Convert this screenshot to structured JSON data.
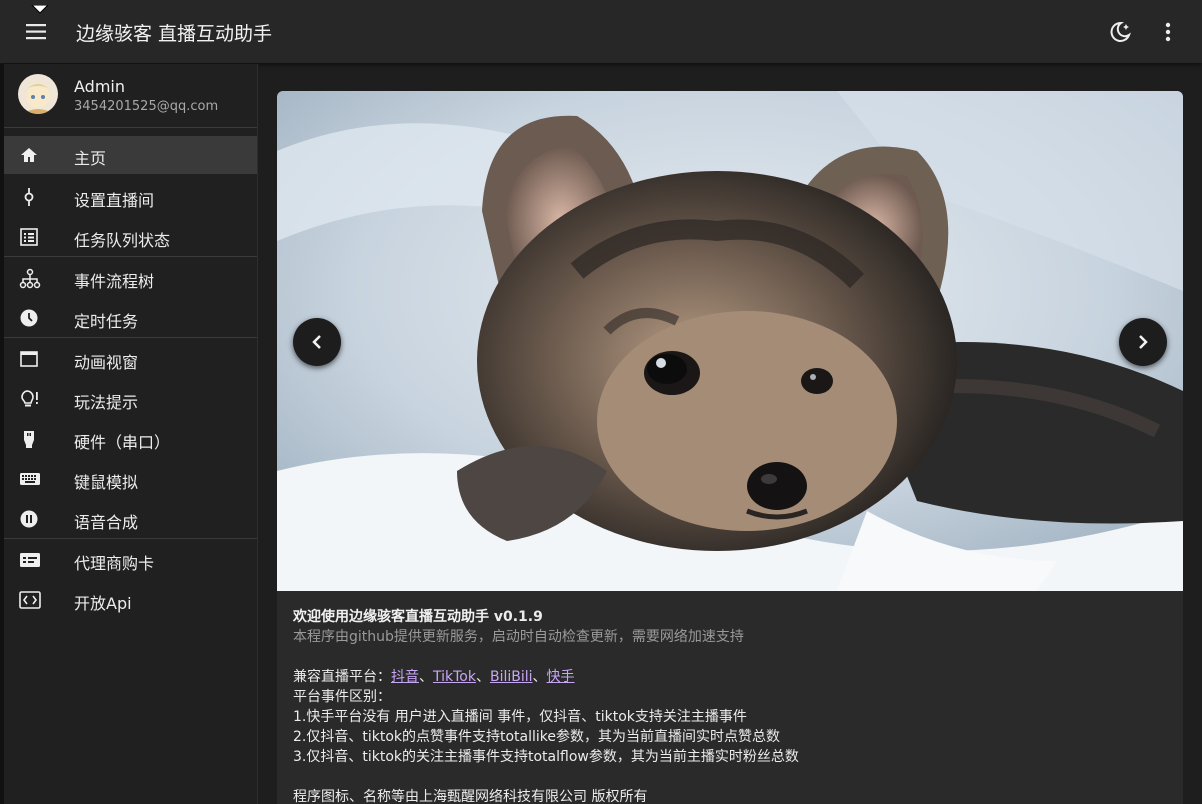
{
  "header": {
    "title": "边缘骇客 直播互动助手",
    "menu_icon": "hamburger-menu-icon",
    "theme_icon": "dark-mode-icon",
    "more_icon": "more-vertical-icon"
  },
  "user": {
    "name": "Admin",
    "email": "3454201525@qq.com"
  },
  "sidebar": {
    "items": [
      {
        "label": "主页",
        "icon": "home-icon",
        "active": true
      },
      {
        "label": "设置直播间",
        "icon": "live-connect-icon"
      },
      {
        "label": "任务队列状态",
        "icon": "list-icon"
      },
      {
        "label": "事件流程树",
        "icon": "tree-icon"
      },
      {
        "label": "定时任务",
        "icon": "clock-icon"
      },
      {
        "label": "动画视窗",
        "icon": "window-icon"
      },
      {
        "label": "玩法提示",
        "icon": "lightbulb-icon"
      },
      {
        "label": "硬件（串口）",
        "icon": "usb-icon"
      },
      {
        "label": "键鼠模拟",
        "icon": "keyboard-icon"
      },
      {
        "label": "语音合成",
        "icon": "voice-icon"
      },
      {
        "label": "代理商购卡",
        "icon": "card-icon"
      },
      {
        "label": "开放Api",
        "icon": "api-icon"
      }
    ]
  },
  "carousel": {
    "prev_icon": "chevron-left-icon",
    "next_icon": "chevron-right-icon",
    "image": "yorkshire-puppy-photo"
  },
  "content": {
    "welcome_text": "欢迎使用边缘骇客直播互动助手 ",
    "version": "v0.1.9",
    "update_note": "本程序由github提供更新服务，启动时自动检查更新，需要网络加速支持",
    "platforms_label": "兼容直播平台：",
    "platforms": [
      "抖音",
      "TikTok",
      "BiliBili",
      "快手"
    ],
    "separator": "、",
    "events_title": "平台事件区别：",
    "events": [
      "1.快手平台没有 用户进入直播间 事件，仅抖音、tiktok支持关注主播事件",
      "2.仅抖音、tiktok的点赞事件支持totallike参数，其为当前直播间实时点赞总数",
      "3.仅抖音、tiktok的关注主播事件支持totalflow参数，其为当前主播实时粉丝总数"
    ],
    "footer_partial": "程序图标、名称等由上海甄醒网络科技有限公司 版权所有"
  }
}
